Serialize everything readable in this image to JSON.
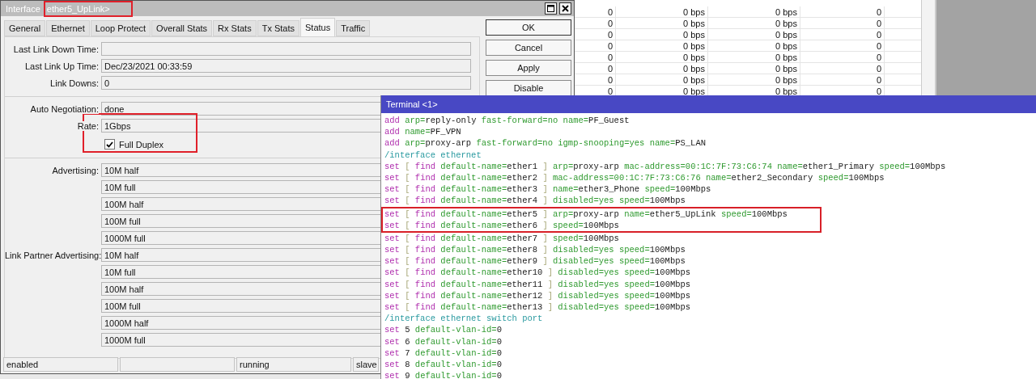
{
  "interface_window": {
    "title": "Interface",
    "subtitle": "ether5_UpLink>",
    "subtitle_highlighted": true,
    "tabs": [
      {
        "label": "General",
        "selected": false
      },
      {
        "label": "Ethernet",
        "selected": false
      },
      {
        "label": "Loop Protect",
        "selected": false
      },
      {
        "label": "Overall Stats",
        "selected": false
      },
      {
        "label": "Rx Stats",
        "selected": false
      },
      {
        "label": "Tx Stats",
        "selected": false
      },
      {
        "label": "Status",
        "selected": true
      },
      {
        "label": "Traffic",
        "selected": false
      }
    ],
    "sections": [
      {
        "rows": [
          {
            "kind": "field",
            "label": "Last Link Down Time:"
          },
          {
            "kind": "field",
            "label": "Last Link Up Time:",
            "value": "Dec/23/2021 00:33:59"
          },
          {
            "kind": "field",
            "label": "Link Downs:",
            "value": "0"
          }
        ]
      },
      {
        "rows": [
          {
            "kind": "field",
            "label": "Auto Negotiation:",
            "value": "done"
          },
          {
            "kind": "field",
            "label": "Rate:",
            "value": "1Gbps",
            "highlighted": true
          },
          {
            "kind": "checkbox",
            "label": "Full Duplex",
            "checked": true,
            "highlighted": true
          }
        ]
      },
      {
        "rows": [
          {
            "kind": "field",
            "label": "Advertising:",
            "value": "10M half"
          },
          {
            "kind": "field",
            "value": "10M full"
          },
          {
            "kind": "field",
            "value": "100M half"
          },
          {
            "kind": "field",
            "value": "100M full"
          },
          {
            "kind": "field",
            "value": "1000M full"
          },
          {
            "kind": "field",
            "label": "Link Partner Advertising:",
            "value": "10M half"
          },
          {
            "kind": "field",
            "value": "10M full"
          },
          {
            "kind": "field",
            "value": "100M half"
          },
          {
            "kind": "field",
            "value": "100M full"
          },
          {
            "kind": "field",
            "value": "1000M half"
          },
          {
            "kind": "field",
            "value": "1000M full"
          }
        ]
      }
    ],
    "buttons": [
      "OK",
      "Cancel",
      "Apply",
      "Disable"
    ],
    "status_bar": [
      {
        "kind": "text",
        "text": "enabled"
      },
      {
        "kind": "empty"
      },
      {
        "kind": "text",
        "text": "running"
      },
      {
        "kind": "text",
        "text": "slave"
      }
    ]
  },
  "traffic_table": {
    "rows": [
      {
        "cells": [
          "0",
          "0 bps",
          "0 bps",
          "0"
        ]
      },
      {
        "cells": [
          "0",
          "0 bps",
          "0 bps",
          "0"
        ]
      },
      {
        "cells": [
          "0",
          "0 bps",
          "0 bps",
          "0"
        ]
      },
      {
        "cells": [
          "0",
          "0 bps",
          "0 bps",
          "0"
        ]
      },
      {
        "cells": [
          "0",
          "0 bps",
          "0 bps",
          "0"
        ]
      },
      {
        "cells": [
          "0",
          "0 bps",
          "0 bps",
          "0"
        ]
      },
      {
        "cells": [
          "0",
          "0 bps",
          "0 bps",
          "0"
        ]
      },
      {
        "cells": [
          "0",
          "0 bps",
          "0 bps",
          "0"
        ]
      }
    ]
  },
  "terminal": {
    "title": "Terminal <1>",
    "lines": [
      {
        "segments": [
          {
            "text": "add ",
            "kind": "command"
          },
          {
            "text": "arp=",
            "kind": "key"
          },
          {
            "text": "reply-only ",
            "kind": "value"
          },
          {
            "text": "fast-forward=no ",
            "kind": "key"
          },
          {
            "text": "name=",
            "kind": "key"
          },
          {
            "text": "PF_Guest",
            "kind": "value"
          }
        ]
      },
      {
        "segments": [
          {
            "text": "add ",
            "kind": "command"
          },
          {
            "text": "name=",
            "kind": "key"
          },
          {
            "text": "PF_VPN",
            "kind": "value"
          }
        ]
      },
      {
        "segments": [
          {
            "text": "add ",
            "kind": "command"
          },
          {
            "text": "arp=",
            "kind": "key"
          },
          {
            "text": "proxy-arp ",
            "kind": "value"
          },
          {
            "text": "fast-forward=no igmp-snooping=yes ",
            "kind": "key"
          },
          {
            "text": "name=",
            "kind": "key"
          },
          {
            "text": "PS_LAN",
            "kind": "value"
          }
        ]
      },
      {
        "segments": [
          {
            "text": "/interface ethernet",
            "kind": "path"
          }
        ]
      },
      {
        "segments": [
          {
            "text": "set ",
            "kind": "command"
          },
          {
            "text": "[ ",
            "kind": "bracket"
          },
          {
            "text": "find ",
            "kind": "command"
          },
          {
            "text": "default-name=",
            "kind": "key"
          },
          {
            "text": "ether1 ",
            "kind": "value"
          },
          {
            "text": "] ",
            "kind": "bracket"
          },
          {
            "text": "arp=",
            "kind": "key"
          },
          {
            "text": "proxy-arp ",
            "kind": "value"
          },
          {
            "text": "mac-address=00:1C:7F:73:C6:74 ",
            "kind": "key"
          },
          {
            "text": "name=",
            "kind": "key"
          },
          {
            "text": "ether1_Primary ",
            "kind": "value"
          },
          {
            "text": "speed=",
            "kind": "key"
          },
          {
            "text": "100Mbps",
            "kind": "value"
          }
        ]
      },
      {
        "segments": [
          {
            "text": "set ",
            "kind": "command"
          },
          {
            "text": "[ ",
            "kind": "bracket"
          },
          {
            "text": "find ",
            "kind": "command"
          },
          {
            "text": "default-name=",
            "kind": "key"
          },
          {
            "text": "ether2 ",
            "kind": "value"
          },
          {
            "text": "] ",
            "kind": "bracket"
          },
          {
            "text": "mac-address=00:1C:7F:73:C6:76 ",
            "kind": "key"
          },
          {
            "text": "name=",
            "kind": "key"
          },
          {
            "text": "ether2_Secondary ",
            "kind": "value"
          },
          {
            "text": "speed=",
            "kind": "key"
          },
          {
            "text": "100Mbps",
            "kind": "value"
          }
        ]
      },
      {
        "segments": [
          {
            "text": "set ",
            "kind": "command"
          },
          {
            "text": "[ ",
            "kind": "bracket"
          },
          {
            "text": "find ",
            "kind": "command"
          },
          {
            "text": "default-name=",
            "kind": "key"
          },
          {
            "text": "ether3 ",
            "kind": "value"
          },
          {
            "text": "] ",
            "kind": "bracket"
          },
          {
            "text": "name=",
            "kind": "key"
          },
          {
            "text": "ether3_Phone ",
            "kind": "value"
          },
          {
            "text": "speed=",
            "kind": "key"
          },
          {
            "text": "100Mbps",
            "kind": "value"
          }
        ]
      },
      {
        "segments": [
          {
            "text": "set ",
            "kind": "command"
          },
          {
            "text": "[ ",
            "kind": "bracket"
          },
          {
            "text": "find ",
            "kind": "command"
          },
          {
            "text": "default-name=",
            "kind": "key"
          },
          {
            "text": "ether4 ",
            "kind": "value"
          },
          {
            "text": "] ",
            "kind": "bracket"
          },
          {
            "text": "disabled=yes speed=",
            "kind": "key"
          },
          {
            "text": "100Mbps",
            "kind": "value"
          }
        ]
      },
      {
        "highlighted": true,
        "segments": [
          {
            "text": "set ",
            "kind": "command"
          },
          {
            "text": "[ ",
            "kind": "bracket"
          },
          {
            "text": "find ",
            "kind": "command"
          },
          {
            "text": "default-name=",
            "kind": "key"
          },
          {
            "text": "ether5 ",
            "kind": "value"
          },
          {
            "text": "] ",
            "kind": "bracket"
          },
          {
            "text": "arp=",
            "kind": "key"
          },
          {
            "text": "proxy-arp ",
            "kind": "value"
          },
          {
            "text": "name=",
            "kind": "key"
          },
          {
            "text": "ether5_UpLink ",
            "kind": "value"
          },
          {
            "text": "speed=",
            "kind": "key"
          },
          {
            "text": "100Mbps",
            "kind": "value"
          }
        ]
      },
      {
        "highlighted": true,
        "segments": [
          {
            "text": "set ",
            "kind": "command"
          },
          {
            "text": "[ ",
            "kind": "bracket"
          },
          {
            "text": "find ",
            "kind": "command"
          },
          {
            "text": "default-name=",
            "kind": "key"
          },
          {
            "text": "ether6 ",
            "kind": "value"
          },
          {
            "text": "] ",
            "kind": "bracket"
          },
          {
            "text": "speed=",
            "kind": "key"
          },
          {
            "text": "100Mbps",
            "kind": "value"
          }
        ]
      },
      {
        "segments": [
          {
            "text": "set ",
            "kind": "command"
          },
          {
            "text": "[ ",
            "kind": "bracket"
          },
          {
            "text": "find ",
            "kind": "command"
          },
          {
            "text": "default-name=",
            "kind": "key"
          },
          {
            "text": "ether7 ",
            "kind": "value"
          },
          {
            "text": "] ",
            "kind": "bracket"
          },
          {
            "text": "speed=",
            "kind": "key"
          },
          {
            "text": "100Mbps",
            "kind": "value"
          }
        ]
      },
      {
        "segments": [
          {
            "text": "set ",
            "kind": "command"
          },
          {
            "text": "[ ",
            "kind": "bracket"
          },
          {
            "text": "find ",
            "kind": "command"
          },
          {
            "text": "default-name=",
            "kind": "key"
          },
          {
            "text": "ether8 ",
            "kind": "value"
          },
          {
            "text": "] ",
            "kind": "bracket"
          },
          {
            "text": "disabled=yes speed=",
            "kind": "key"
          },
          {
            "text": "100Mbps",
            "kind": "value"
          }
        ]
      },
      {
        "segments": [
          {
            "text": "set ",
            "kind": "command"
          },
          {
            "text": "[ ",
            "kind": "bracket"
          },
          {
            "text": "find ",
            "kind": "command"
          },
          {
            "text": "default-name=",
            "kind": "key"
          },
          {
            "text": "ether9 ",
            "kind": "value"
          },
          {
            "text": "] ",
            "kind": "bracket"
          },
          {
            "text": "disabled=yes speed=",
            "kind": "key"
          },
          {
            "text": "100Mbps",
            "kind": "value"
          }
        ]
      },
      {
        "segments": [
          {
            "text": "set ",
            "kind": "command"
          },
          {
            "text": "[ ",
            "kind": "bracket"
          },
          {
            "text": "find ",
            "kind": "command"
          },
          {
            "text": "default-name=",
            "kind": "key"
          },
          {
            "text": "ether10 ",
            "kind": "value"
          },
          {
            "text": "] ",
            "kind": "bracket"
          },
          {
            "text": "disabled=yes speed=",
            "kind": "key"
          },
          {
            "text": "100Mbps",
            "kind": "value"
          }
        ]
      },
      {
        "segments": [
          {
            "text": "set ",
            "kind": "command"
          },
          {
            "text": "[ ",
            "kind": "bracket"
          },
          {
            "text": "find ",
            "kind": "command"
          },
          {
            "text": "default-name=",
            "kind": "key"
          },
          {
            "text": "ether11 ",
            "kind": "value"
          },
          {
            "text": "] ",
            "kind": "bracket"
          },
          {
            "text": "disabled=yes speed=",
            "kind": "key"
          },
          {
            "text": "100Mbps",
            "kind": "value"
          }
        ]
      },
      {
        "segments": [
          {
            "text": "set ",
            "kind": "command"
          },
          {
            "text": "[ ",
            "kind": "bracket"
          },
          {
            "text": "find ",
            "kind": "command"
          },
          {
            "text": "default-name=",
            "kind": "key"
          },
          {
            "text": "ether12 ",
            "kind": "value"
          },
          {
            "text": "] ",
            "kind": "bracket"
          },
          {
            "text": "disabled=yes speed=",
            "kind": "key"
          },
          {
            "text": "100Mbps",
            "kind": "value"
          }
        ]
      },
      {
        "segments": [
          {
            "text": "set ",
            "kind": "command"
          },
          {
            "text": "[ ",
            "kind": "bracket"
          },
          {
            "text": "find ",
            "kind": "command"
          },
          {
            "text": "default-name=",
            "kind": "key"
          },
          {
            "text": "ether13 ",
            "kind": "value"
          },
          {
            "text": "] ",
            "kind": "bracket"
          },
          {
            "text": "disabled=yes speed=",
            "kind": "key"
          },
          {
            "text": "100Mbps",
            "kind": "value"
          }
        ]
      },
      {
        "segments": [
          {
            "text": "/interface ethernet switch port",
            "kind": "path"
          }
        ]
      },
      {
        "segments": [
          {
            "text": "set ",
            "kind": "command"
          },
          {
            "text": "5 ",
            "kind": "value"
          },
          {
            "text": "default-vlan-id=",
            "kind": "key"
          },
          {
            "text": "0",
            "kind": "value"
          }
        ]
      },
      {
        "segments": [
          {
            "text": "set ",
            "kind": "command"
          },
          {
            "text": "6 ",
            "kind": "value"
          },
          {
            "text": "default-vlan-id=",
            "kind": "key"
          },
          {
            "text": "0",
            "kind": "value"
          }
        ]
      },
      {
        "segments": [
          {
            "text": "set ",
            "kind": "command"
          },
          {
            "text": "7 ",
            "kind": "value"
          },
          {
            "text": "default-vlan-id=",
            "kind": "key"
          },
          {
            "text": "0",
            "kind": "value"
          }
        ]
      },
      {
        "segments": [
          {
            "text": "set ",
            "kind": "command"
          },
          {
            "text": "8 ",
            "kind": "value"
          },
          {
            "text": "default-vlan-id=",
            "kind": "key"
          },
          {
            "text": "0",
            "kind": "value"
          }
        ]
      },
      {
        "segments": [
          {
            "text": "set ",
            "kind": "command"
          },
          {
            "text": "9 ",
            "kind": "value"
          },
          {
            "text": "default-vlan-id=",
            "kind": "key"
          },
          {
            "text": "0",
            "kind": "value"
          }
        ]
      }
    ]
  }
}
